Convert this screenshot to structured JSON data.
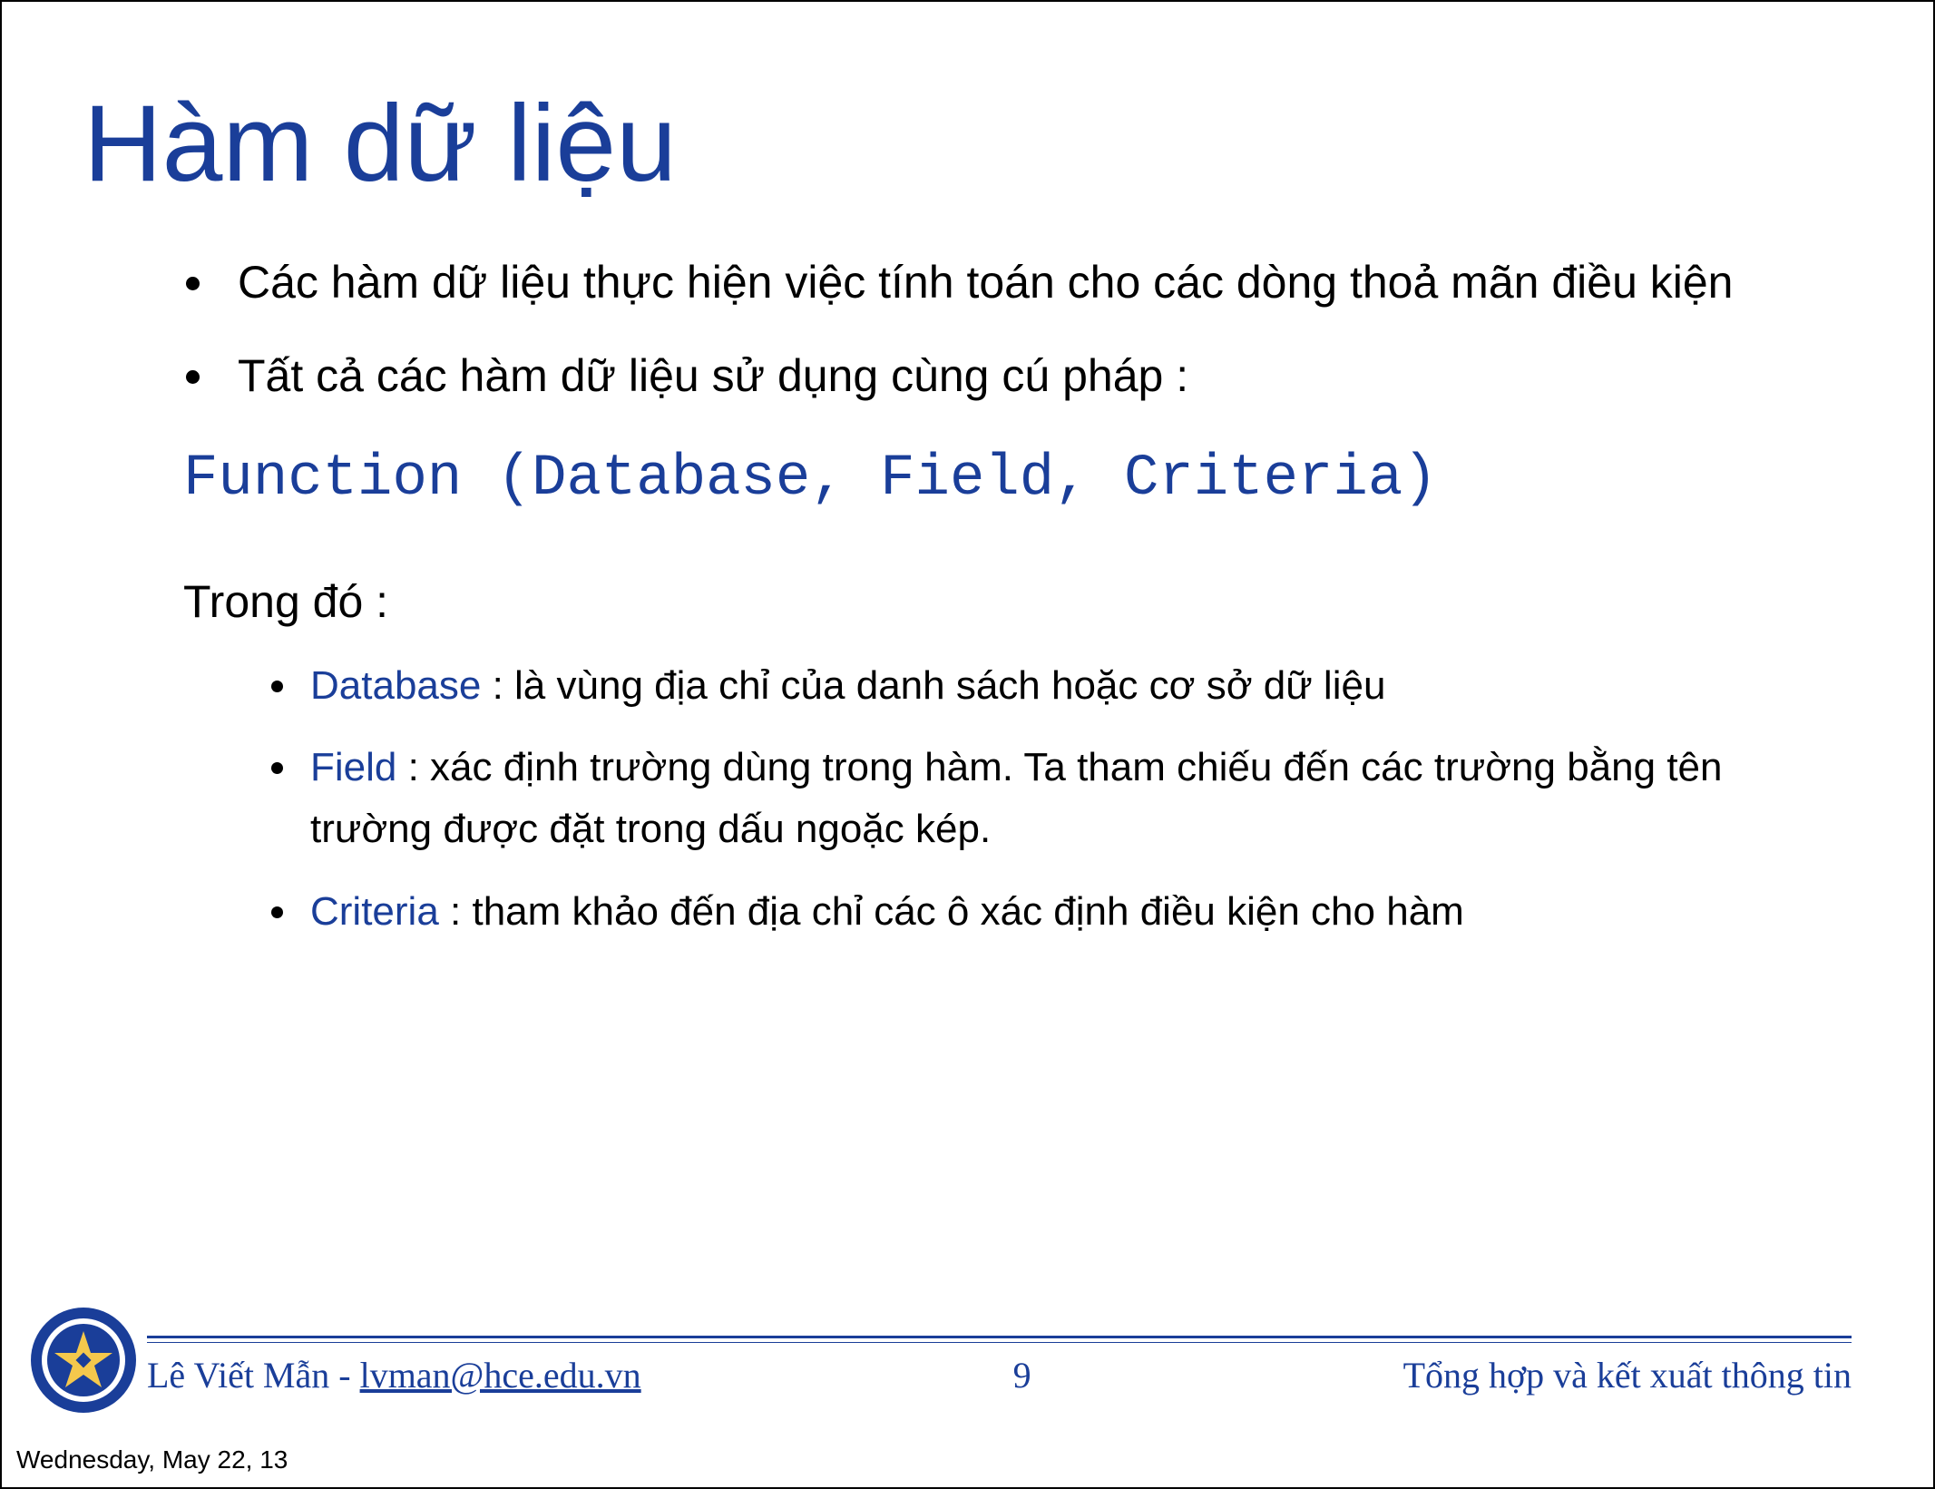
{
  "title": "Hàm dữ liệu",
  "bullets": {
    "b1": "Các hàm dữ liệu thực hiện việc tính toán cho các dòng thoả mãn điều kiện",
    "b2": "Tất cả các hàm dữ liệu sử dụng cùng cú pháp :"
  },
  "code": "Function (Database, Field, Criteria)",
  "sub_heading": "Trong đó :",
  "terms": {
    "database": {
      "name": "Database",
      "desc": " : là vùng địa chỉ của danh sách hoặc cơ sở dữ liệu"
    },
    "field": {
      "name": "Field",
      "desc": " : xác định trường dùng trong hàm. Ta tham chiếu đến các trường bằng tên trường được đặt trong dấu ngoặc kép."
    },
    "criteria": {
      "name": "Criteria",
      "desc": " : tham khảo đến địa chỉ các ô xác định điều kiện cho hàm"
    }
  },
  "footer": {
    "author": "Lê Viết Mẫn - ",
    "email": "lvman@hce.edu.vn",
    "page": "9",
    "right": "Tổng hợp và kết xuất thông tin"
  },
  "date": "Wednesday, May 22, 13",
  "colors": {
    "accent": "#1a3e99"
  }
}
